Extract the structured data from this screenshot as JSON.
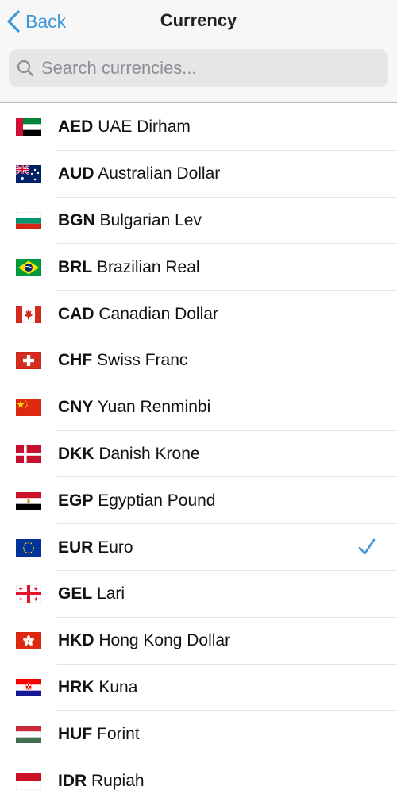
{
  "header": {
    "back_label": "Back",
    "title": "Currency",
    "accent_color": "#3d98db"
  },
  "search": {
    "placeholder": "Search currencies..."
  },
  "currencies": [
    {
      "code": "AED",
      "name": "UAE Dirham",
      "flag": "uae-flag-icon",
      "selected": false
    },
    {
      "code": "AUD",
      "name": "Australian Dollar",
      "flag": "australia-flag-icon",
      "selected": false
    },
    {
      "code": "BGN",
      "name": "Bulgarian Lev",
      "flag": "bulgaria-flag-icon",
      "selected": false
    },
    {
      "code": "BRL",
      "name": "Brazilian Real",
      "flag": "brazil-flag-icon",
      "selected": false
    },
    {
      "code": "CAD",
      "name": "Canadian Dollar",
      "flag": "canada-flag-icon",
      "selected": false
    },
    {
      "code": "CHF",
      "name": "Swiss Franc",
      "flag": "switzerland-flag-icon",
      "selected": false
    },
    {
      "code": "CNY",
      "name": "Yuan Renminbi",
      "flag": "china-flag-icon",
      "selected": false
    },
    {
      "code": "DKK",
      "name": "Danish Krone",
      "flag": "denmark-flag-icon",
      "selected": false
    },
    {
      "code": "EGP",
      "name": "Egyptian Pound",
      "flag": "egypt-flag-icon",
      "selected": false
    },
    {
      "code": "EUR",
      "name": "Euro",
      "flag": "eu-flag-icon",
      "selected": true
    },
    {
      "code": "GEL",
      "name": "Lari",
      "flag": "georgia-flag-icon",
      "selected": false
    },
    {
      "code": "HKD",
      "name": "Hong Kong Dollar",
      "flag": "hong-kong-flag-icon",
      "selected": false
    },
    {
      "code": "HRK",
      "name": "Kuna",
      "flag": "croatia-flag-icon",
      "selected": false
    },
    {
      "code": "HUF",
      "name": "Forint",
      "flag": "hungary-flag-icon",
      "selected": false
    },
    {
      "code": "IDR",
      "name": "Rupiah",
      "flag": "indonesia-flag-icon",
      "selected": false
    }
  ]
}
